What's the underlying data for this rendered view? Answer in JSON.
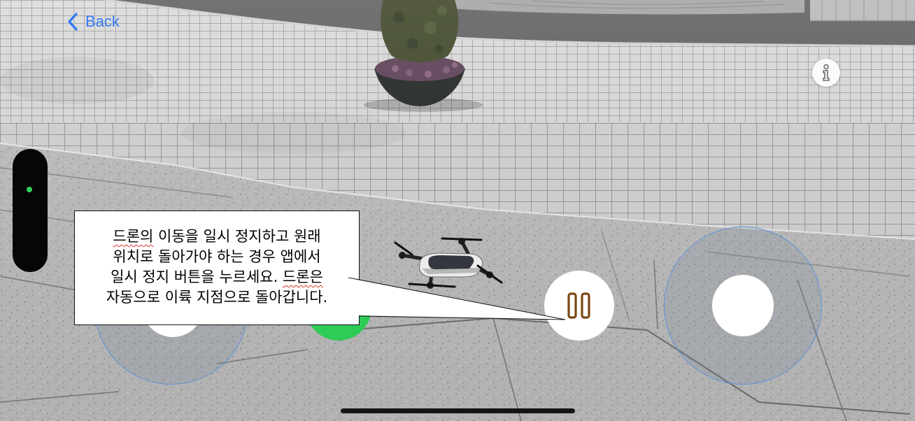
{
  "nav": {
    "back_label": "Back",
    "back_icon": "chevron-left-icon"
  },
  "info_button": {
    "icon": "info-icon"
  },
  "controls": {
    "pause_icon": "pause-icon"
  },
  "callout": {
    "lines": [
      [
        {
          "text": "드론의",
          "flagged": true
        },
        {
          "text": " 이동을 일시 정지하고 원래",
          "flagged": false
        }
      ],
      [
        {
          "text": "위치로 돌아가야 하는 경우 앱에서",
          "flagged": false
        }
      ],
      [
        {
          "text": "일시 정지 버튼을 누르세요. ",
          "flagged": false
        },
        {
          "text": "드론은",
          "flagged": true
        }
      ],
      [
        {
          "text": "자동으로 이륙 지점으로 돌아갑니다.",
          "flagged": false
        }
      ]
    ]
  },
  "colors": {
    "accent": "#3478F6",
    "go_button": "#2FCB57",
    "pause_icon": "#7A4812",
    "joystick_ring": "#5E93D8",
    "indicator": "#2FD158"
  }
}
